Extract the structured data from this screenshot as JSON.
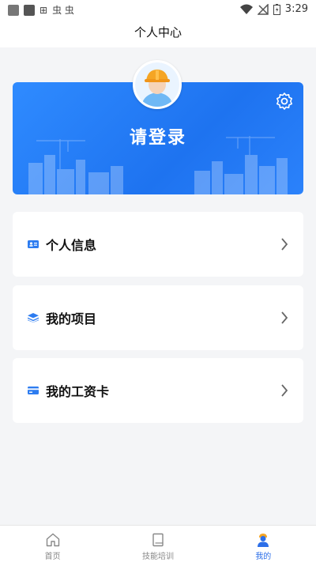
{
  "status_bar": {
    "time": "3:29",
    "left_glyph": "虫 虫"
  },
  "header": {
    "title": "个人中心"
  },
  "profile": {
    "login_prompt": "请登录"
  },
  "menu": [
    {
      "label": "个人信息",
      "icon": "id-card-icon"
    },
    {
      "label": "我的项目",
      "icon": "stack-icon"
    },
    {
      "label": "我的工资卡",
      "icon": "bank-card-icon"
    }
  ],
  "tabs": [
    {
      "label": "首页",
      "icon": "home-icon",
      "active": false
    },
    {
      "label": "技能培训",
      "icon": "book-icon",
      "active": false
    },
    {
      "label": "我的",
      "icon": "user-icon",
      "active": true
    }
  ],
  "colors": {
    "accent": "#1e73f0",
    "active_tab": "#2d6fe8",
    "background": "#f4f5f7"
  }
}
